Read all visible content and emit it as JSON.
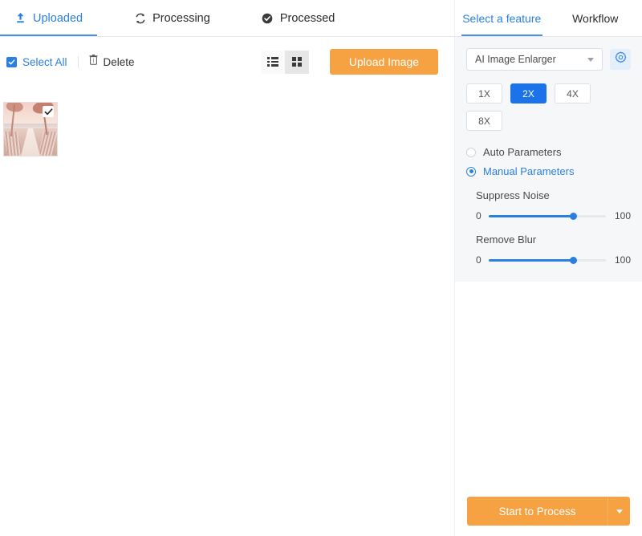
{
  "tabs": [
    {
      "id": "uploaded",
      "label": "Uploaded",
      "icon": "upload-icon",
      "active": true
    },
    {
      "id": "processing",
      "label": "Processing",
      "icon": "refresh-icon",
      "active": false
    },
    {
      "id": "processed",
      "label": "Processed",
      "icon": "check-circle-icon",
      "active": false
    }
  ],
  "toolbar": {
    "select_all_label": "Select All",
    "delete_label": "Delete",
    "upload_label": "Upload Image",
    "view_list": "list-view",
    "view_grid": "grid-view",
    "active_view": "grid"
  },
  "gallery": {
    "items": [
      {
        "name": "beach-pier-photo",
        "selected": true
      }
    ]
  },
  "panel": {
    "tabs": [
      {
        "id": "feature",
        "label": "Select a feature",
        "active": true
      },
      {
        "id": "workflow",
        "label": "Workflow",
        "active": false
      }
    ],
    "feature_select": {
      "value": "AI Image Enlarger",
      "options": [
        "AI Image Enlarger"
      ]
    },
    "settings_icon": "gear-icon",
    "scales": [
      {
        "label": "1X",
        "active": false
      },
      {
        "label": "2X",
        "active": true
      },
      {
        "label": "4X",
        "active": false
      },
      {
        "label": "8X",
        "active": false
      }
    ],
    "param_mode": {
      "auto_label": "Auto Parameters",
      "manual_label": "Manual Parameters",
      "selected": "manual"
    },
    "sliders": [
      {
        "label": "Suppress Noise",
        "min": "0",
        "max": "100",
        "value": 72
      },
      {
        "label": "Remove Blur",
        "min": "0",
        "max": "100",
        "value": 72
      }
    ],
    "start_label": "Start to Process",
    "start_more_icon": "chevron-down-icon"
  },
  "colors": {
    "accent_blue": "#2a7fe0",
    "active_blue": "#1a73e8",
    "orange": "#f7a242",
    "panel_bg": "#f6f7f9"
  }
}
